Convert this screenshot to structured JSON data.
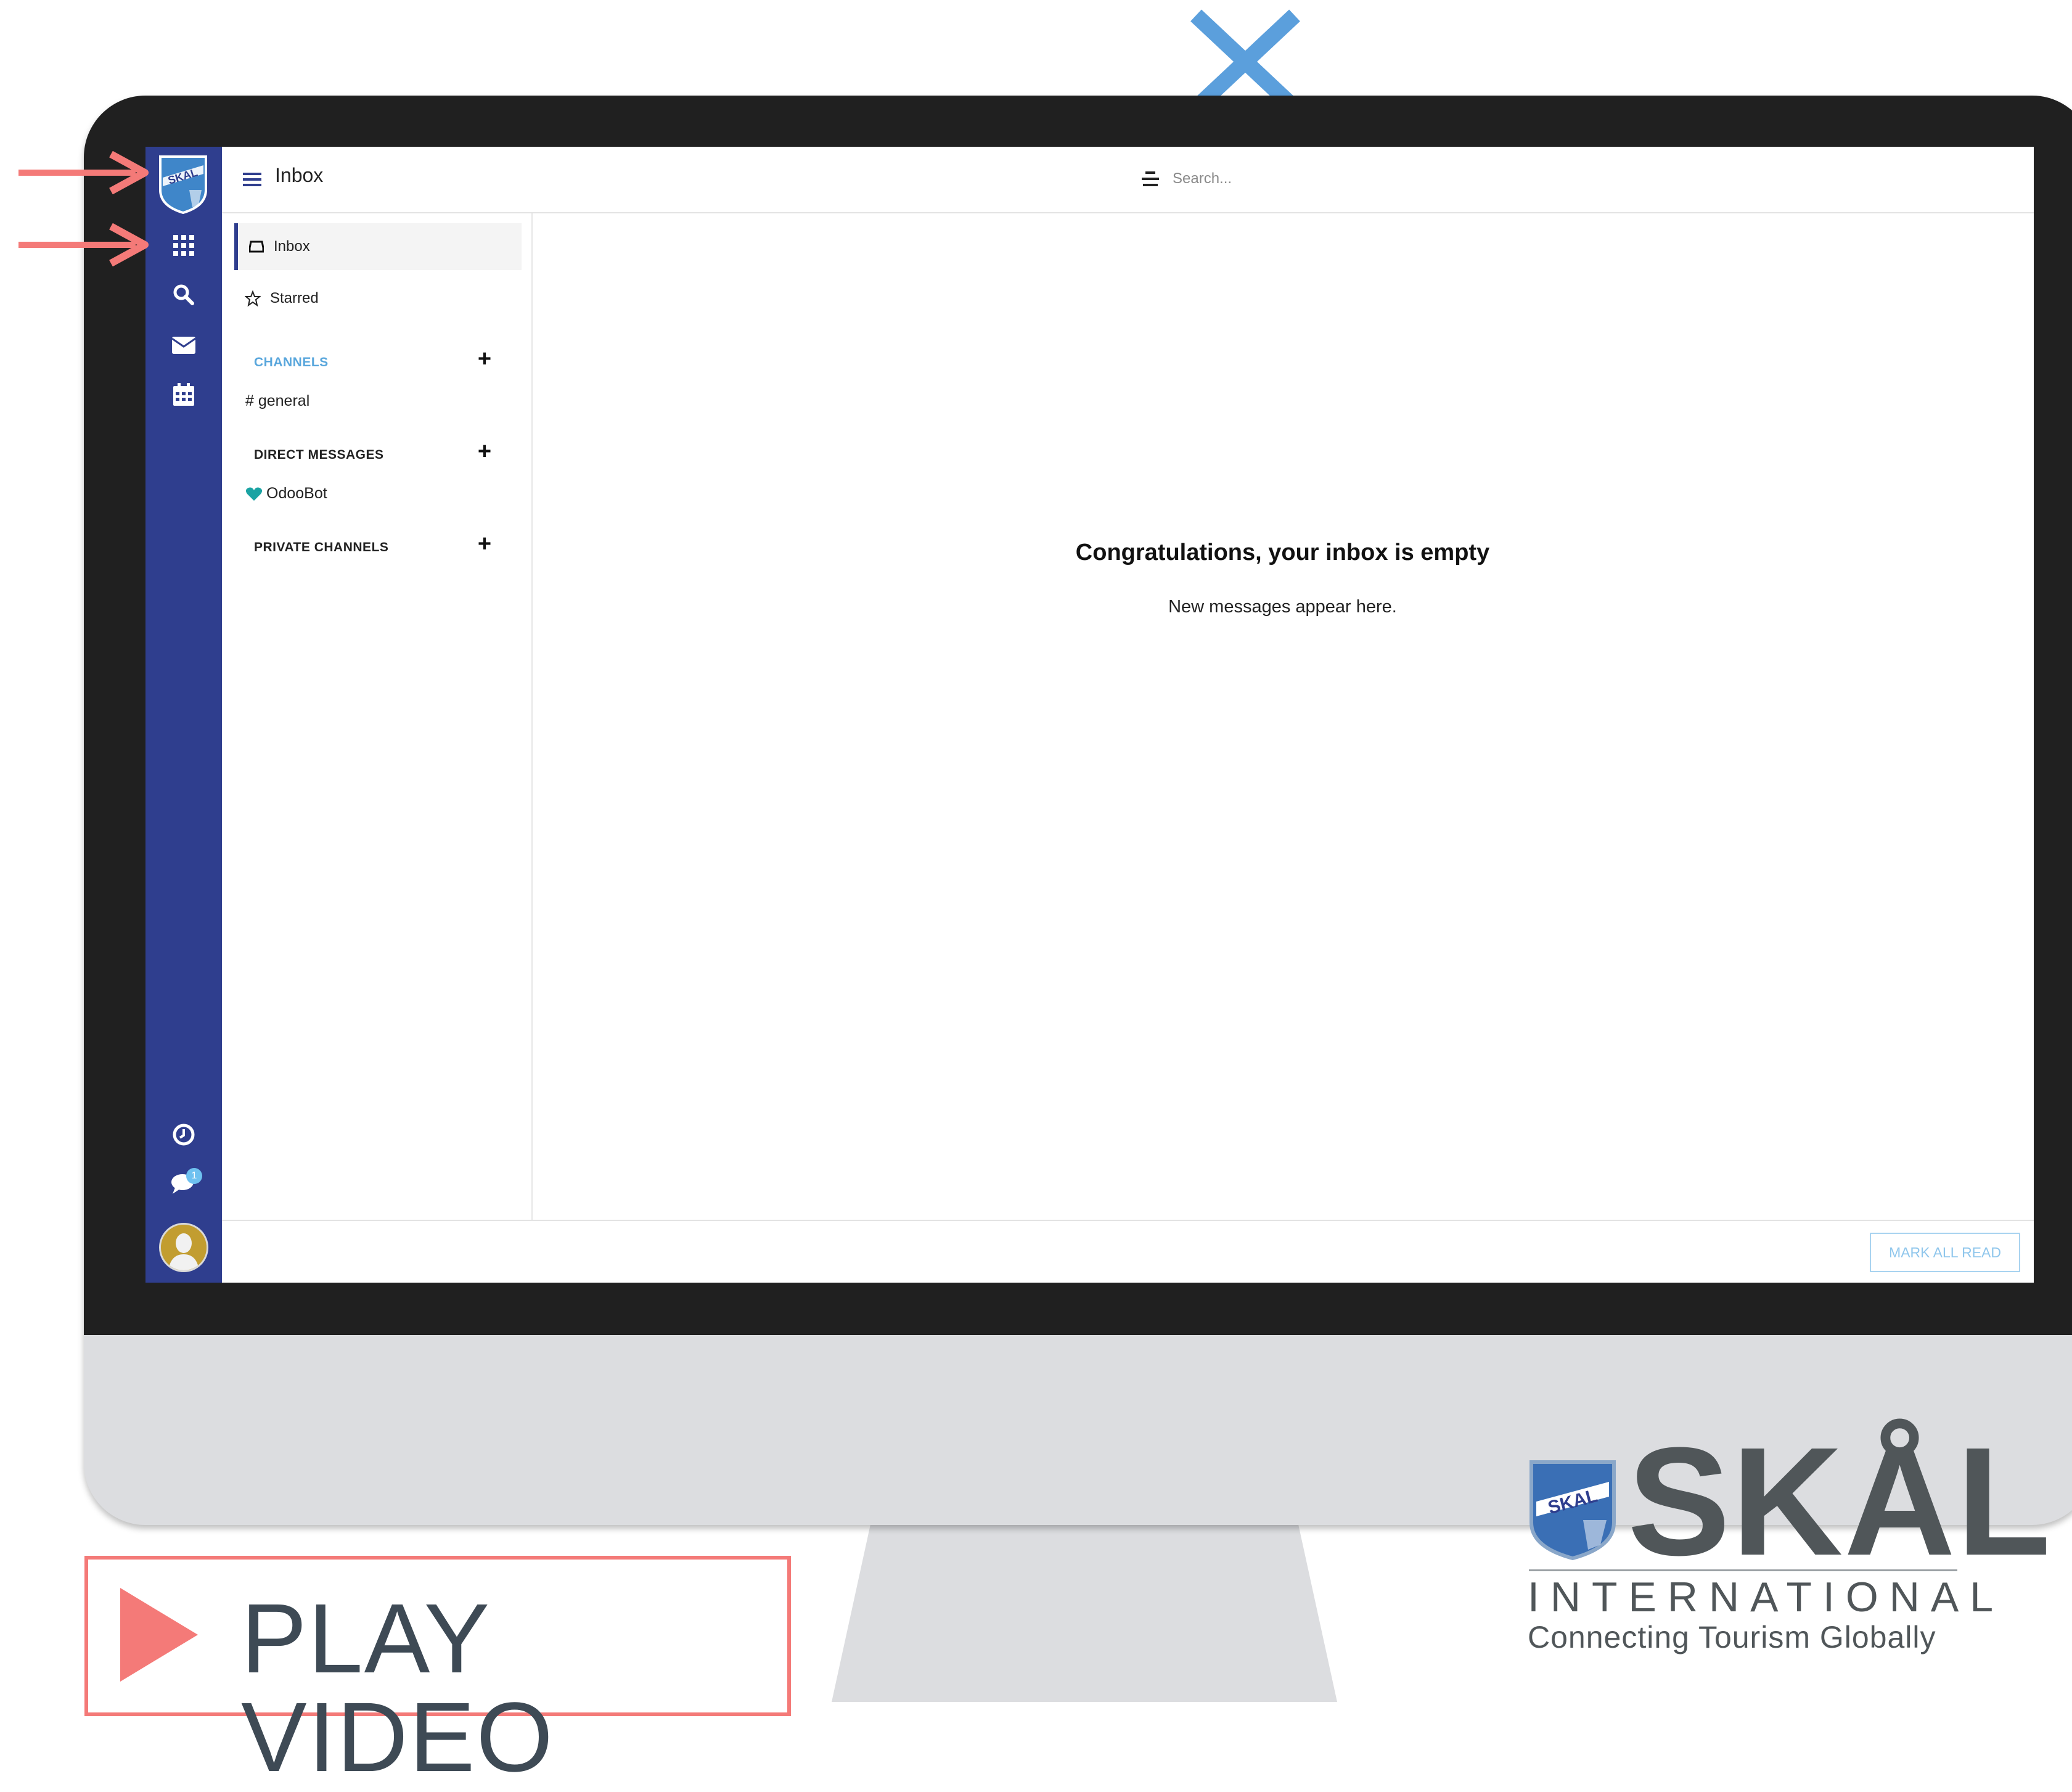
{
  "overlay": {
    "play_video_label": "PLAY VIDEO",
    "close_icon": "close-icon",
    "accent_color": "#f47a78"
  },
  "topbar": {
    "title": "Inbox",
    "search_placeholder": "Search..."
  },
  "app_strip": {
    "color": "#2f3e8e",
    "icons": [
      "company-logo",
      "apps-grid-icon",
      "search-icon",
      "envelope-icon",
      "calendar-icon",
      "clock-icon",
      "chat-icon",
      "avatar"
    ],
    "chat_badge": "1"
  },
  "left_panel": {
    "inbox_label": "Inbox",
    "starred_label": "Starred",
    "channels_title": "CHANNELS",
    "channels": [
      "# general"
    ],
    "direct_messages_title": "DIRECT MESSAGES",
    "direct_messages": [
      "OdooBot"
    ],
    "private_channels_title": "PRIVATE CHANNELS"
  },
  "main": {
    "empty_title": "Congratulations, your inbox is empty",
    "empty_subtitle": "New messages appear here.",
    "mark_all_read": "MARK ALL READ"
  },
  "brand": {
    "name": "SKÅL",
    "subtitle": "INTERNATIONAL",
    "tagline": "Connecting Tourism Globally"
  }
}
